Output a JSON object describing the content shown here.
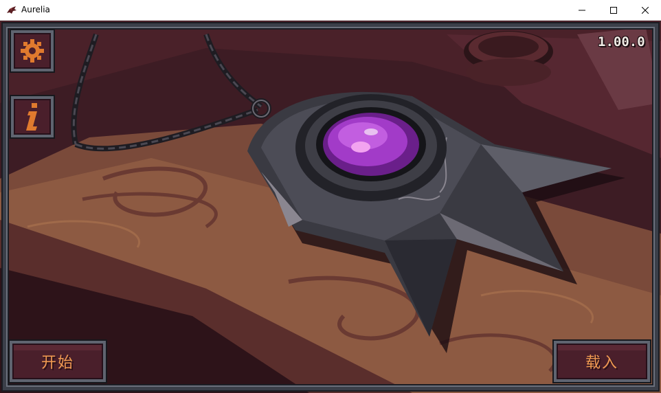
{
  "window": {
    "title": "Aurelia",
    "app_icon": "dragon-icon",
    "controls": [
      "minimize-icon",
      "maximize-icon",
      "close-icon"
    ]
  },
  "game": {
    "version": "1.00.0",
    "settings_icon": "gear-icon",
    "info_icon": "info-icon",
    "start_label": "开始",
    "load_label": "载入"
  },
  "colors": {
    "accent": "#f09a52",
    "button_bg": "#4a1f2b",
    "frame": "#5f6470",
    "gem": "#a23bc8"
  }
}
